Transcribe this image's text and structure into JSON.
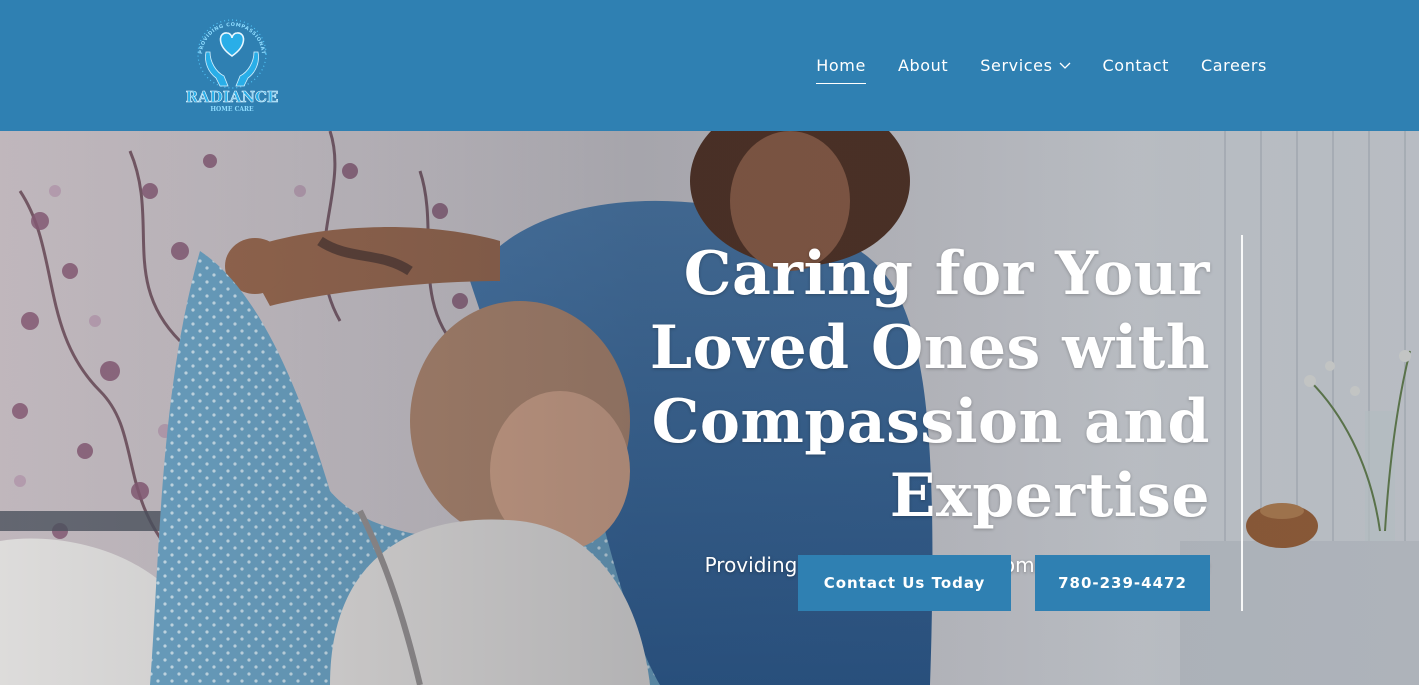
{
  "brand": {
    "name": "RADIANCE",
    "tagline": "HOME CARE",
    "ring_text": "PROVIDING COMPASSIONATE CARE",
    "logo_icon": "heart-in-hands-icon",
    "colors": {
      "primary": "#2f80b2",
      "logo_blue": "#29aee8"
    }
  },
  "nav": {
    "items": [
      {
        "label": "Home",
        "active": true
      },
      {
        "label": "About",
        "active": false
      },
      {
        "label": "Services",
        "active": false,
        "has_dropdown": true
      },
      {
        "label": "Contact",
        "active": false
      },
      {
        "label": "Careers",
        "active": false
      }
    ]
  },
  "hero": {
    "title": "Caring for Your Loved Ones with Compassion and Expertise",
    "subtitle": "Providing quality care in the comfort of your home",
    "buttons": {
      "contact_label": "Contact Us Today",
      "phone_label": "780-239-4472"
    },
    "image_description_icon": "caregiver-photo"
  }
}
